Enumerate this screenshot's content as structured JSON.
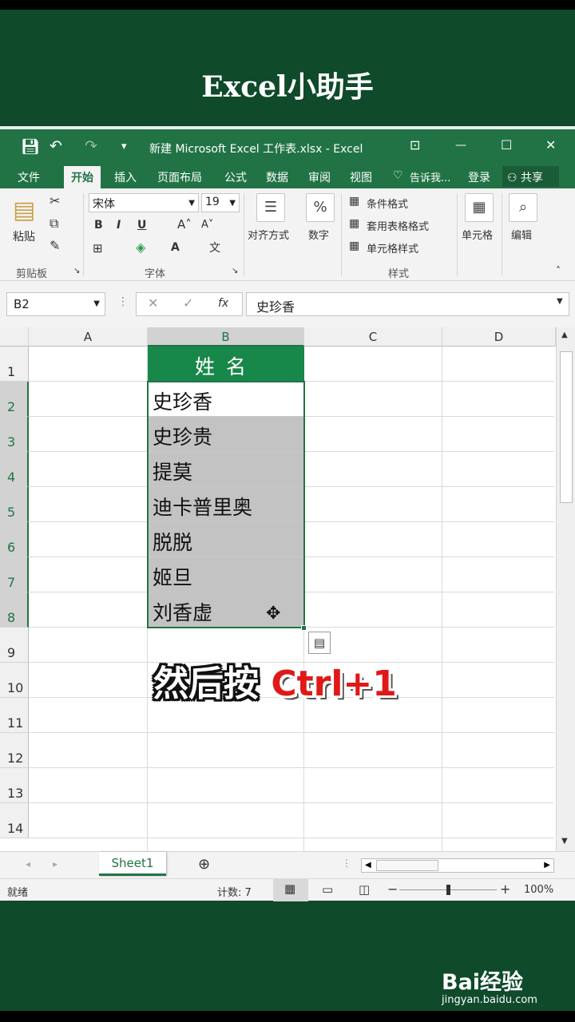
{
  "video": {
    "title": "Excel小助手"
  },
  "window": {
    "title": "新建 Microsoft Excel 工作表.xlsx - Excel",
    "controls": {
      "minimize": "—",
      "maximize": "☐",
      "close": "✕"
    }
  },
  "ribbon_tabs": [
    {
      "label": "文件"
    },
    {
      "label": "开始"
    },
    {
      "label": "插入"
    },
    {
      "label": "页面布局"
    },
    {
      "label": "公式"
    },
    {
      "label": "数据"
    },
    {
      "label": "审阅"
    },
    {
      "label": "视图"
    },
    {
      "label": "告诉我..."
    },
    {
      "label": "登录"
    },
    {
      "label": "共享"
    }
  ],
  "ribbon": {
    "paste_label": "粘贴",
    "clipboard_group": "剪贴板",
    "font_name": "宋体",
    "font_size": "19",
    "font_group": "字体",
    "align_label": "对齐方式",
    "number_label": "数字",
    "cond_format": "条件格式",
    "table_format": "套用表格格式",
    "cell_style": "单元格样式",
    "styles_group": "样式",
    "cells_label": "单元格",
    "edit_label": "编辑"
  },
  "formula_bar": {
    "name_box": "B2",
    "value": "史珍香"
  },
  "columns": [
    "A",
    "B",
    "C",
    "D"
  ],
  "rows": [
    "1",
    "2",
    "3",
    "4",
    "5",
    "6",
    "7",
    "8",
    "9",
    "10",
    "11",
    "12",
    "13",
    "14"
  ],
  "table": {
    "header": "姓名",
    "names": [
      "史珍香",
      "史珍贵",
      "提莫",
      "迪卡普里奥",
      "脱脱",
      "姬旦",
      "刘香虚"
    ]
  },
  "caption": {
    "plain": "然后按",
    "highlight": "Ctrl+1"
  },
  "sheet_tab": "Sheet1",
  "status": {
    "ready": "就绪",
    "count": "计数: 7",
    "zoom": "100%"
  },
  "watermark": {
    "brand": "Bai经验",
    "url": "jingyan.baidu.com"
  }
}
